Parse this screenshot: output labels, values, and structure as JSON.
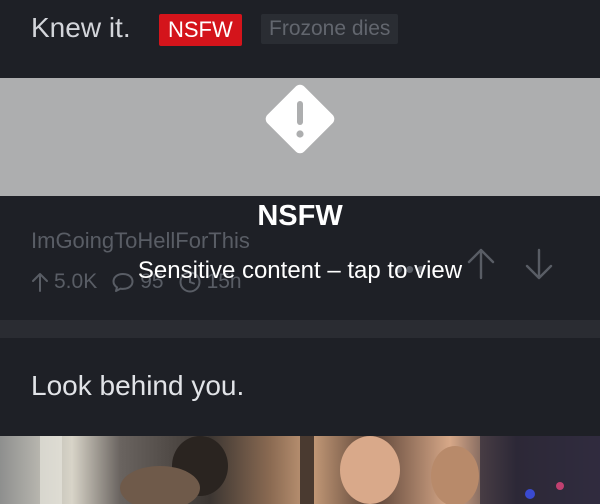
{
  "post1": {
    "title": "Knew it.",
    "nsfw_badge": "NSFW",
    "flair": "Frozone dies",
    "subreddit": "ImGoingToHellForThis",
    "upvotes": "5.0K",
    "comments": "95",
    "age": "15h",
    "more_label": "•••"
  },
  "overlay": {
    "title": "NSFW",
    "subtitle": "Sensitive content – tap to view"
  },
  "post2": {
    "title": "Look behind you."
  },
  "colors": {
    "background": "#1e2026",
    "badge_red": "#d4141b",
    "muted_text": "#595d65",
    "blur_gray": "#adaeaf"
  },
  "icons": [
    "warning-icon",
    "upvote-icon",
    "comment-icon",
    "clock-icon",
    "more-icon",
    "arrow-up-icon",
    "arrow-down-icon"
  ]
}
